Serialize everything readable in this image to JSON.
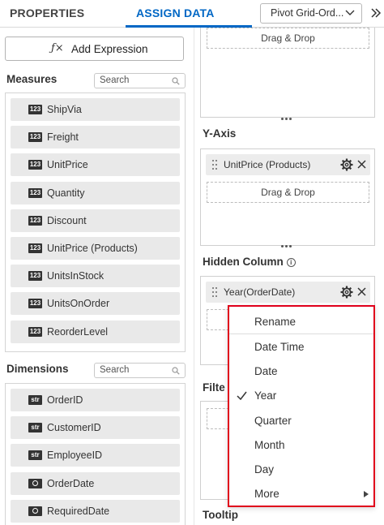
{
  "tabs": {
    "properties": "PROPERTIES",
    "assign_data": "ASSIGN DATA"
  },
  "widget_select": {
    "value": "Pivot Grid-Ord..."
  },
  "add_expression": {
    "icon": "fx-icon",
    "label": "Add Expression"
  },
  "measures": {
    "title": "Measures",
    "search_placeholder": "Search",
    "items": [
      {
        "badge": "123",
        "label": "ShipVia"
      },
      {
        "badge": "123",
        "label": "Freight"
      },
      {
        "badge": "123",
        "label": "UnitPrice"
      },
      {
        "badge": "123",
        "label": "Quantity"
      },
      {
        "badge": "123",
        "label": "Discount"
      },
      {
        "badge": "123",
        "label": "UnitPrice (Products)"
      },
      {
        "badge": "123",
        "label": "UnitsInStock"
      },
      {
        "badge": "123",
        "label": "UnitsOnOrder"
      },
      {
        "badge": "123",
        "label": "ReorderLevel"
      }
    ]
  },
  "dimensions": {
    "title": "Dimensions",
    "search_placeholder": "Search",
    "items": [
      {
        "badge": "str",
        "label": "OrderID"
      },
      {
        "badge": "str",
        "label": "CustomerID"
      },
      {
        "badge": "str",
        "label": "EmployeeID"
      },
      {
        "badge": "date-icon",
        "label": "OrderDate"
      },
      {
        "badge": "date-icon",
        "label": "RequiredDate"
      }
    ]
  },
  "right_panel": {
    "top_drop_label": "Drag & Drop",
    "y_axis": {
      "title": "Y-Axis",
      "pill_label": "UnitPrice (Products)",
      "drop_label": "Drag & Drop"
    },
    "hidden_column": {
      "title": "Hidden Column",
      "pill_label": "Year(OrderDate)"
    },
    "filter_title": "Filte",
    "tooltip_title": "Tooltip"
  },
  "context_menu": {
    "rename": "Rename",
    "items": [
      {
        "label": "Date Time",
        "checked": false
      },
      {
        "label": "Date",
        "checked": false
      },
      {
        "label": "Year",
        "checked": true
      },
      {
        "label": "Quarter",
        "checked": false
      },
      {
        "label": "Month",
        "checked": false
      },
      {
        "label": "Day",
        "checked": false
      },
      {
        "label": "More",
        "checked": false,
        "submenu": true
      }
    ]
  },
  "colors": {
    "accent": "#0067c5",
    "highlight_border": "#e0001b"
  }
}
